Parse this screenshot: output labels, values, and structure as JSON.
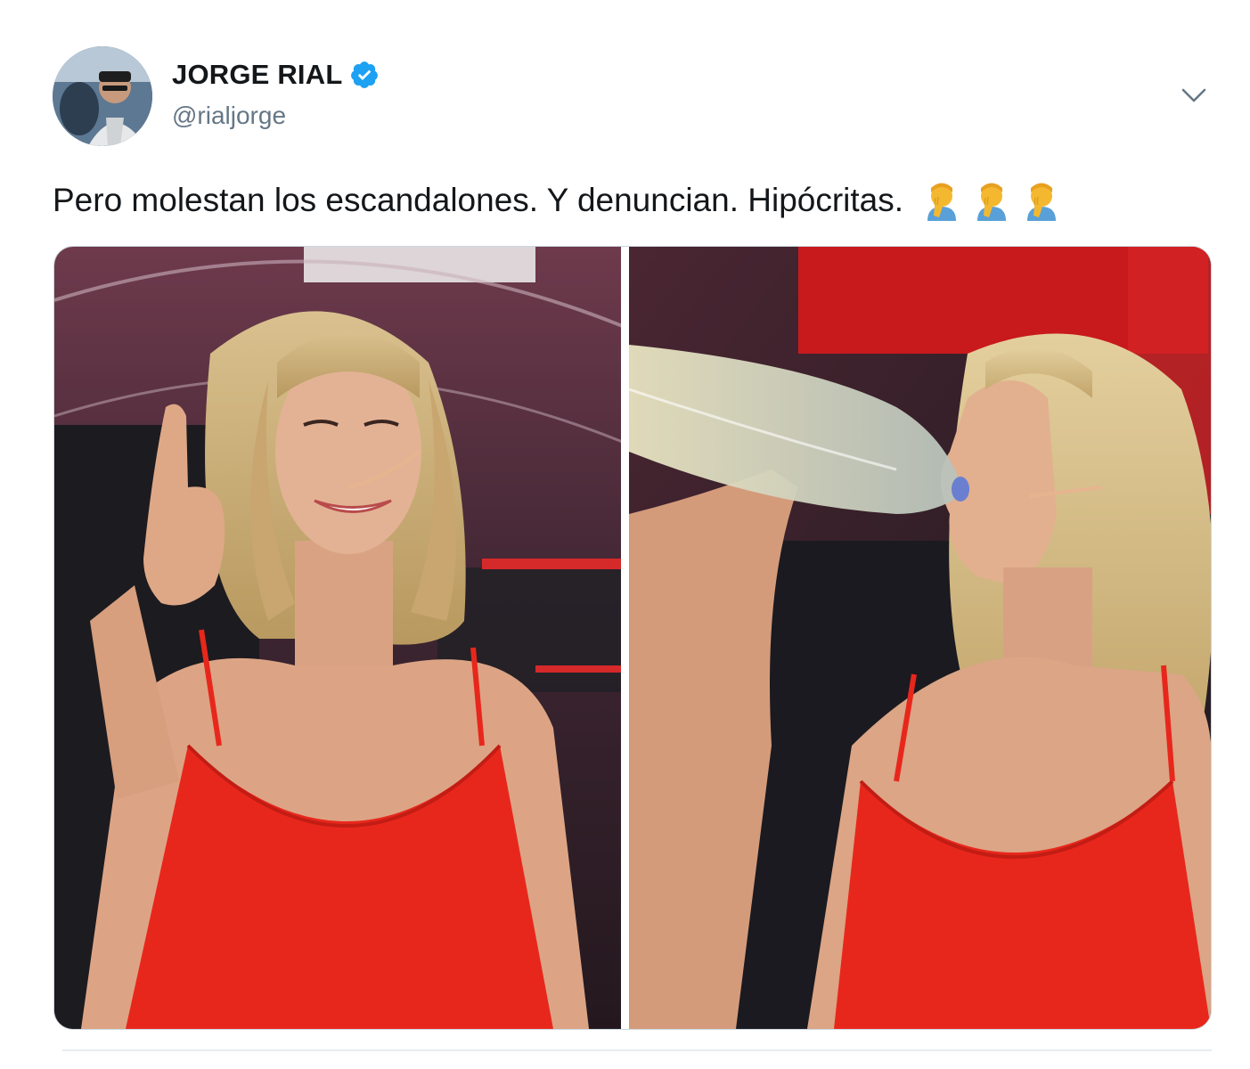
{
  "tweet": {
    "display_name": "JORGE RIAL",
    "handle": "@rialjorge",
    "text": "Pero molestan los escandalones. Y denuncian. Hipócritas.",
    "emoji": [
      "facepalm-icon",
      "facepalm-icon",
      "facepalm-icon"
    ],
    "verified": true
  },
  "media": {
    "count": 2,
    "photos": [
      "photo-left",
      "photo-right"
    ]
  },
  "colors": {
    "text": "#14171a",
    "secondary_text": "#657786",
    "verified_blue": "#1da1f2",
    "border": "#ccd6dd",
    "dress_red": "#e8271c"
  }
}
